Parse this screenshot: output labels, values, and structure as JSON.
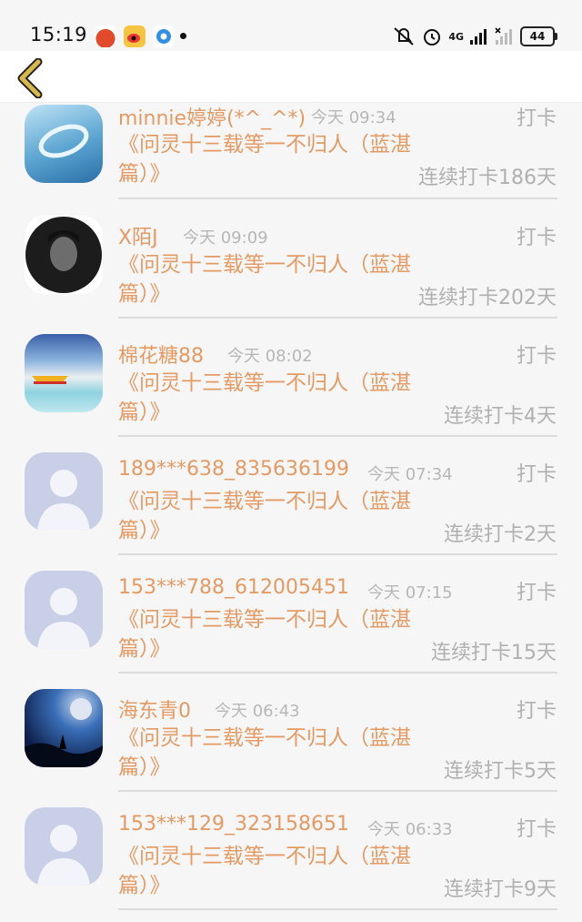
{
  "status_bar": {
    "time": "15:19",
    "network": "4G",
    "battery": "44"
  },
  "nav": {
    "back_icon": "chevron-left-icon"
  },
  "entries": [
    {
      "user": "minnie婷婷(*^_^*)",
      "date": "今天 09:34",
      "action": "打卡",
      "book": "《问灵十三载等一不归人（蓝湛篇）》",
      "streak": "连续打卡186天",
      "avatar": "water-ring"
    },
    {
      "user": "X陌J",
      "date": "今天 09:09",
      "action": "打卡",
      "book": "《问灵十三载等一不归人（蓝湛篇）》",
      "streak": "连续打卡202天",
      "avatar": "portrait"
    },
    {
      "user": "棉花糖88",
      "date": "今天 08:02",
      "action": "打卡",
      "book": "《问灵十三载等一不归人（蓝湛篇）》",
      "streak": "连续打卡4天",
      "avatar": "beach-boat"
    },
    {
      "user": "189***638_835636199",
      "date": "今天 07:34",
      "action": "打卡",
      "book": "《问灵十三载等一不归人（蓝湛篇）》",
      "streak": "连续打卡2天",
      "avatar": "default"
    },
    {
      "user": "153***788_612005451",
      "date": "今天 07:15",
      "action": "打卡",
      "book": "《问灵十三载等一不归人（蓝湛篇）》",
      "streak": "连续打卡15天",
      "avatar": "default"
    },
    {
      "user": "海东青0",
      "date": "今天 06:43",
      "action": "打卡",
      "book": "《问灵十三载等一不归人（蓝湛篇）》",
      "streak": "连续打卡5天",
      "avatar": "night-moon"
    },
    {
      "user": "153***129_323158651",
      "date": "今天 06:33",
      "action": "打卡",
      "book": "《问灵十三载等一不归人（蓝湛篇）》",
      "streak": "连续打卡9天",
      "avatar": "default"
    }
  ],
  "colors": {
    "accent": "#e49a63",
    "muted": "#b0b0b0",
    "back": "#d8b84a"
  }
}
